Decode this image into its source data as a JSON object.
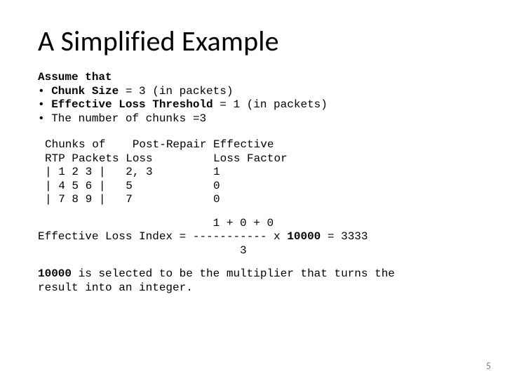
{
  "title": "A Simplified Example",
  "assume": {
    "heading": "Assume that",
    "bullet": "• ",
    "chunk_size_label": "Chunk Size",
    "chunk_size_rest": " = 3 (in packets)",
    "elt_label": "Effective Loss Threshold",
    "elt_rest": " = 1 (in packets)",
    "num_chunks": "The number of chunks =3"
  },
  "table": {
    "col1_h1": "Chunks of   ",
    "col1_h2": "RTP Packets ",
    "col2_h1": " Post-Repair ",
    "col2_h2": "Loss         ",
    "col3_h1": "Effective",
    "col3_h2": "Loss Factor",
    "r1c1": "| 1 2 3 |   ",
    "r1c2": "2, 3         ",
    "r1c3": "1",
    "r2c1": "| 4 5 6 |   ",
    "r2c2": "5            ",
    "r2c3": "0",
    "r3c1": "| 7 8 9 |   ",
    "r3c2": "7            ",
    "r3c3": "0"
  },
  "eq": {
    "line1": "                          1 + 0 + 0",
    "line2_left": "Effective Loss Index = ----------- x ",
    "line2_mult": "10000",
    "line2_right": " = 3333",
    "line3": "                              3"
  },
  "note": {
    "bold": "10000",
    "rest": " is selected to be the multiplier that turns the\nresult into an integer."
  },
  "page": "5"
}
